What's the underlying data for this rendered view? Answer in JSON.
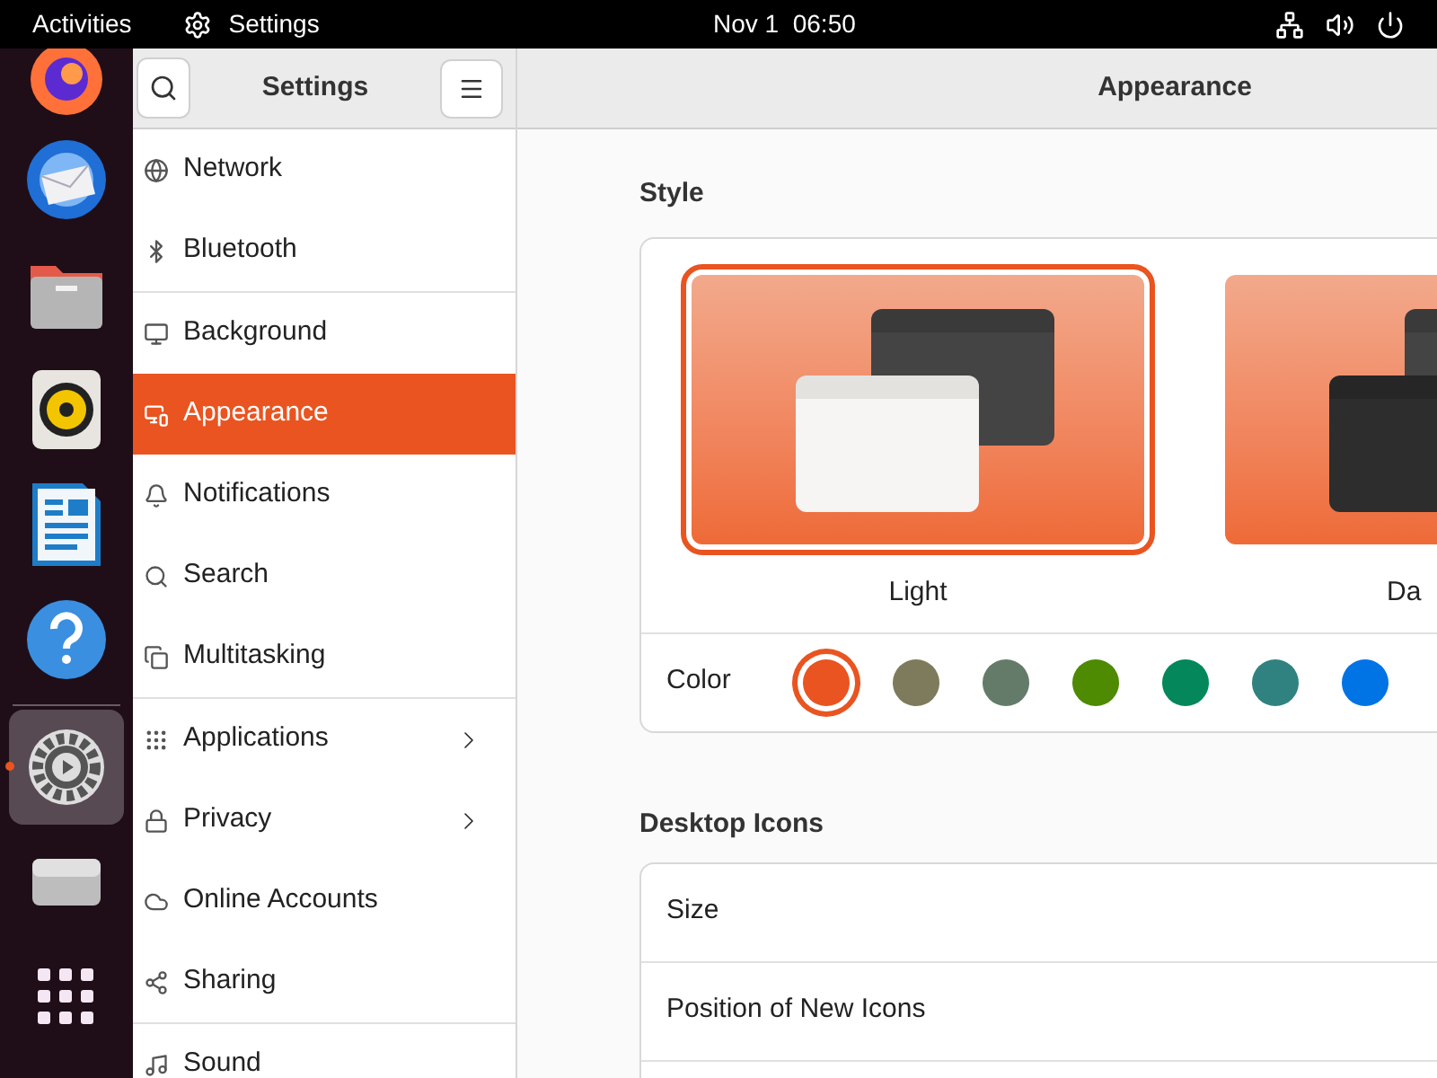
{
  "top_bar": {
    "activities": "Activities",
    "app_name": "Settings",
    "clock": "Nov 1  06:50"
  },
  "dock": {
    "items": [
      {
        "kind": "firefox",
        "active": false
      },
      {
        "kind": "mail",
        "active": false
      },
      {
        "kind": "files",
        "active": false
      },
      {
        "kind": "music",
        "active": false
      },
      {
        "kind": "writer",
        "active": false
      },
      {
        "kind": "help",
        "active": false
      },
      {
        "kind": "settings",
        "active": true
      },
      {
        "kind": "drive",
        "active": false
      },
      {
        "kind": "apps",
        "active": false
      }
    ]
  },
  "sidebar": {
    "title": "Settings",
    "groups": [
      {
        "items": [
          {
            "label": "Network",
            "selected": false,
            "submenu": false
          },
          {
            "label": "Bluetooth",
            "selected": false,
            "submenu": false
          }
        ]
      },
      {
        "items": [
          {
            "label": "Background",
            "selected": false,
            "submenu": false
          },
          {
            "label": "Appearance",
            "selected": true,
            "submenu": false
          },
          {
            "label": "Notifications",
            "selected": false,
            "submenu": false
          },
          {
            "label": "Search",
            "selected": false,
            "submenu": false
          },
          {
            "label": "Multitasking",
            "selected": false,
            "submenu": false
          }
        ]
      },
      {
        "items": [
          {
            "label": "Applications",
            "selected": false,
            "submenu": true
          },
          {
            "label": "Privacy",
            "selected": false,
            "submenu": true
          },
          {
            "label": "Online Accounts",
            "selected": false,
            "submenu": false
          },
          {
            "label": "Sharing",
            "selected": false,
            "submenu": false
          }
        ]
      },
      {
        "items": [
          {
            "label": "Sound",
            "selected": false,
            "submenu": false
          }
        ]
      }
    ]
  },
  "main": {
    "title": "Appearance",
    "style": {
      "heading": "Style",
      "options": [
        {
          "label": "Light",
          "kind": "light",
          "selected": true
        },
        {
          "label": "Da",
          "kind": "dark",
          "selected": false
        }
      ],
      "color_label": "Color",
      "colors": [
        {
          "color": "#e95420",
          "selected": true
        },
        {
          "color": "#7e7b5c",
          "selected": false
        },
        {
          "color": "#657b69",
          "selected": false
        },
        {
          "color": "#4e8a02",
          "selected": false
        },
        {
          "color": "#03875b",
          "selected": false
        },
        {
          "color": "#308280",
          "selected": false
        },
        {
          "color": "#0073e5",
          "selected": false
        }
      ]
    },
    "desktop_icons": {
      "heading": "Desktop Icons",
      "rows": [
        {
          "label": "Size"
        },
        {
          "label": "Position of New Icons"
        }
      ]
    }
  }
}
